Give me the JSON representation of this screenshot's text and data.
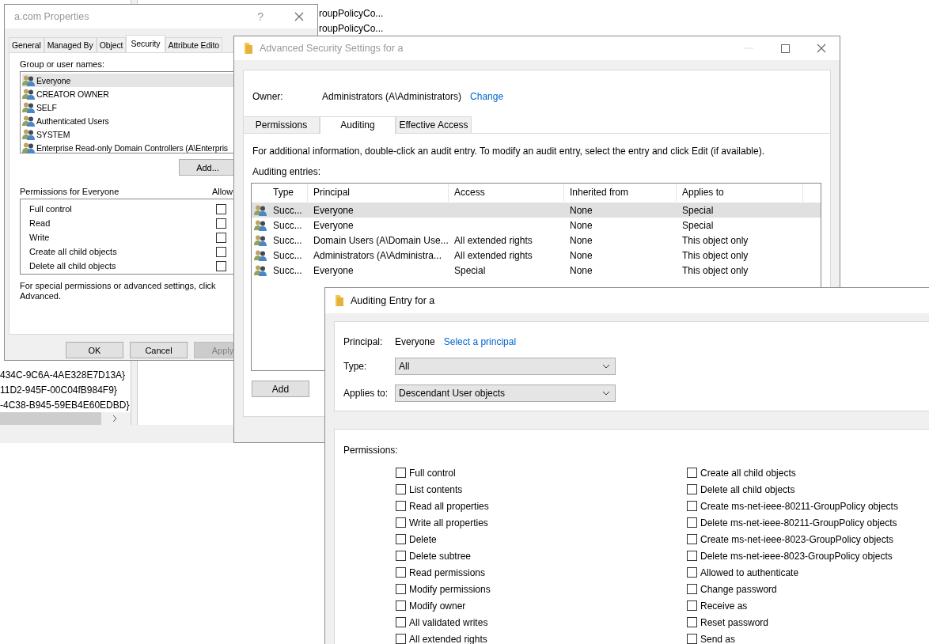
{
  "background_window": {
    "list_items": [
      "roupPolicyCo...",
      "roupPolicyCo..."
    ],
    "tree_items": [
      "434C-9C6A-4AE328E7D13A}",
      "11D2-945F-00C04fB984F9}",
      "-4C38-B945-59EB4E60EDBD}"
    ]
  },
  "properties_dialog": {
    "title": "a.com Properties",
    "help_button": "?",
    "tabs": [
      {
        "label": "General",
        "selected": false
      },
      {
        "label": "Managed By",
        "selected": false
      },
      {
        "label": "Object",
        "selected": false
      },
      {
        "label": "Security",
        "selected": true
      },
      {
        "label": "Attribute Edito",
        "selected": false
      }
    ],
    "group_label": "Group or user names:",
    "principals": [
      {
        "name": "Everyone",
        "selected": true
      },
      {
        "name": "CREATOR OWNER",
        "selected": false
      },
      {
        "name": "SELF",
        "selected": false
      },
      {
        "name": "Authenticated Users",
        "selected": false
      },
      {
        "name": "SYSTEM",
        "selected": false
      },
      {
        "name": "Enterprise Read-only Domain Controllers (A\\Enterpris",
        "selected": false
      }
    ],
    "add_button": "Add...",
    "permissions_label": "Permissions for Everyone",
    "allow_label": "Allow",
    "permissions": [
      {
        "name": "Full control",
        "allow": false
      },
      {
        "name": "Read",
        "allow": false
      },
      {
        "name": "Write",
        "allow": false
      },
      {
        "name": "Create all child objects",
        "allow": false
      },
      {
        "name": "Delete all child objects",
        "allow": false
      }
    ],
    "advanced_note": "For special permissions or advanced settings, click Advanced.",
    "buttons": [
      {
        "label": "OK",
        "disabled": false
      },
      {
        "label": "Cancel",
        "disabled": false
      },
      {
        "label": "Apply",
        "disabled": true
      }
    ]
  },
  "advanced_window": {
    "title": "Advanced Security Settings for a",
    "owner_label": "Owner:",
    "owner": "Administrators (A\\Administrators)",
    "change_link": "Change",
    "tabs": [
      {
        "label": "Permissions",
        "selected": false
      },
      {
        "label": "Auditing",
        "selected": true
      },
      {
        "label": "Effective Access",
        "selected": false
      }
    ],
    "info": "For additional information, double-click an audit entry. To modify an audit entry, select the entry and click Edit (if available).",
    "entries_label": "Auditing entries:",
    "columns": [
      "Type",
      "Principal",
      "Access",
      "Inherited from",
      "Applies to"
    ],
    "entries": [
      {
        "type": "Succ...",
        "principal": "Everyone",
        "inherited_from": "None",
        "applies_to": "Special",
        "selected": true
      },
      {
        "type": "Succ...",
        "principal": "Everyone",
        "inherited_from": "None",
        "applies_to": "Special",
        "selected": false
      },
      {
        "type": "Succ...",
        "principal": "Domain Users (A\\Domain Use...",
        "access": "All extended rights",
        "inherited_from": "None",
        "applies_to": "This object only",
        "selected": false
      },
      {
        "type": "Succ...",
        "principal": "Administrators (A\\Administra...",
        "access": "All extended rights",
        "inherited_from": "None",
        "applies_to": "This object only",
        "selected": false
      },
      {
        "type": "Succ...",
        "principal": "Everyone",
        "access": "Special",
        "inherited_from": "None",
        "applies_to": "This object only",
        "selected": false
      }
    ],
    "add_button": "Add"
  },
  "auditing_entry": {
    "title": "Auditing Entry for a",
    "principal_label": "Principal:",
    "principal": "Everyone",
    "select_link": "Select a principal",
    "type_label": "Type:",
    "type_value": "All",
    "applies_label": "Applies to:",
    "applies_value": "Descendant User objects",
    "permissions_label": "Permissions:",
    "permissions": [
      {
        "name": "Full control",
        "checked": false
      },
      {
        "name": "List contents",
        "checked": false
      },
      {
        "name": "Read all properties",
        "checked": false
      },
      {
        "name": "Write all properties",
        "checked": false
      },
      {
        "name": "Delete",
        "checked": false
      },
      {
        "name": "Delete subtree",
        "checked": false
      },
      {
        "name": "Read permissions",
        "checked": false
      },
      {
        "name": "Modify permissions",
        "checked": false
      },
      {
        "name": "Modify owner",
        "checked": false
      },
      {
        "name": "All validated writes",
        "checked": false
      },
      {
        "name": "All extended rights",
        "checked": false
      },
      {
        "name": "Create all child objects",
        "checked": false
      },
      {
        "name": "Delete all child objects",
        "checked": false
      },
      {
        "name": "Create ms-net-ieee-80211-GroupPolicy objects",
        "checked": false
      },
      {
        "name": "Delete ms-net-ieee-80211-GroupPolicy objects",
        "checked": false
      },
      {
        "name": "Create ms-net-ieee-8023-GroupPolicy objects",
        "checked": false
      },
      {
        "name": "Delete ms-net-ieee-8023-GroupPolicy objects",
        "checked": false
      },
      {
        "name": "Allowed to authenticate",
        "checked": false
      },
      {
        "name": "Change password",
        "checked": false
      },
      {
        "name": "Receive as",
        "checked": false
      },
      {
        "name": "Reset password",
        "checked": false
      },
      {
        "name": "Send as",
        "checked": false
      }
    ]
  }
}
